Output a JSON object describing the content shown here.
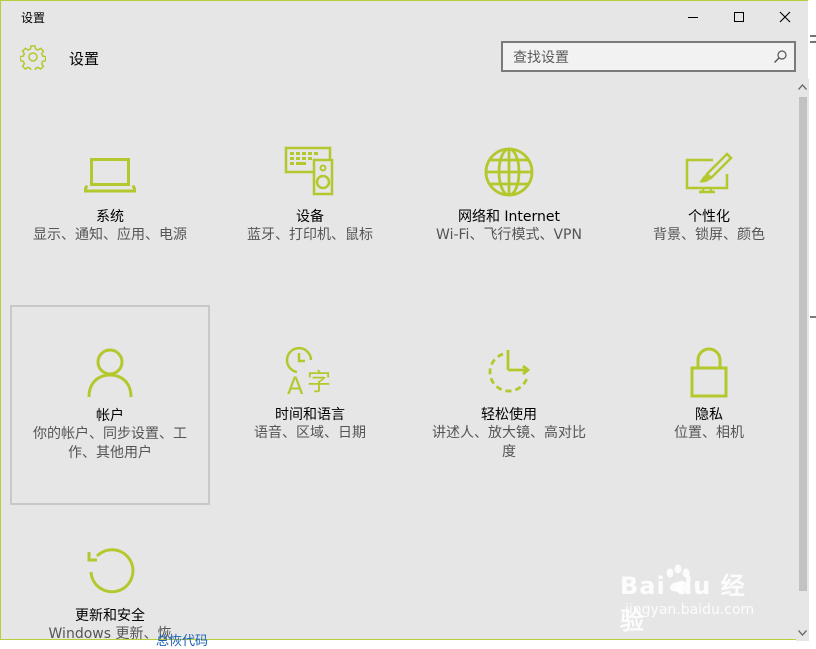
{
  "window": {
    "title": "设置"
  },
  "header": {
    "title": "设置"
  },
  "search": {
    "placeholder": "查找设置"
  },
  "tiles": [
    {
      "name": "系统",
      "desc": "显示、通知、应用、电源",
      "icon": "laptop-icon"
    },
    {
      "name": "设备",
      "desc": "蓝牙、打印机、鼠标",
      "icon": "keyboard-speaker-icon"
    },
    {
      "name": "网络和 Internet",
      "desc": "Wi-Fi、飞行模式、VPN",
      "icon": "globe-icon"
    },
    {
      "name": "个性化",
      "desc": "背景、锁屏、颜色",
      "icon": "paintbrush-screen-icon"
    },
    {
      "name": "帐户",
      "desc": "你的帐户、同步设置、工作、其他用户",
      "icon": "person-icon"
    },
    {
      "name": "时间和语言",
      "desc": "语音、区域、日期",
      "icon": "clock-language-icon"
    },
    {
      "name": "轻松使用",
      "desc": "讲述人、放大镜、高对比度",
      "icon": "ease-of-access-icon"
    },
    {
      "name": "隐私",
      "desc": "位置、相机",
      "icon": "lock-icon"
    },
    {
      "name": "更新和安全",
      "desc": "Windows 更新、恢",
      "icon": "refresh-icon"
    }
  ],
  "watermark": {
    "top": "Bai du 经验",
    "bottom": "jingyan.baidu.com"
  },
  "bottom_link": "总恢代码",
  "colors": {
    "accent": "#b4c82e",
    "background": "#e6e6e6",
    "border": "#b6cf3a"
  }
}
